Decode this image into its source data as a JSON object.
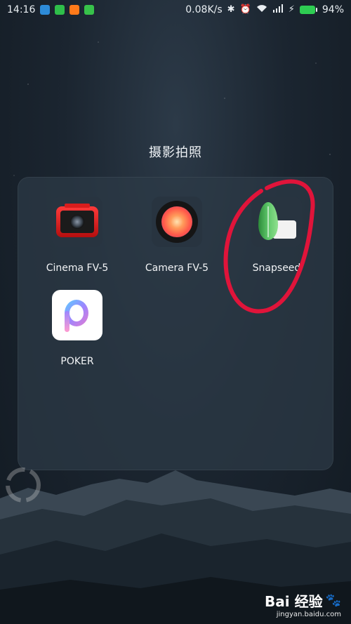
{
  "status_bar": {
    "time": "14:16",
    "network_speed": "0.08K/s",
    "battery_percent": "94%",
    "notification_icons": [
      "usb-icon",
      "sim-icon",
      "orange-app-icon",
      "android-icon"
    ],
    "system_icons": [
      "bluetooth-icon",
      "alarm-icon",
      "wifi-icon",
      "signal-icon",
      "charging-icon"
    ],
    "colors": {
      "battery": "#2ecc52"
    }
  },
  "folder": {
    "title": "摄影拍照",
    "apps": [
      {
        "label": "Cinema FV-5",
        "icon": "cinema-fv5-icon"
      },
      {
        "label": "Camera FV-5",
        "icon": "camera-fv5-icon"
      },
      {
        "label": "Snapseed",
        "icon": "snapseed-icon",
        "highlighted": true
      },
      {
        "label": "POKER",
        "icon": "poker-icon"
      }
    ]
  },
  "annotation": {
    "shape": "circle",
    "color": "#e0143a",
    "target": "Snapseed"
  },
  "watermark": {
    "brand": "Bai 经验",
    "url": "jingyan.baidu.com"
  }
}
